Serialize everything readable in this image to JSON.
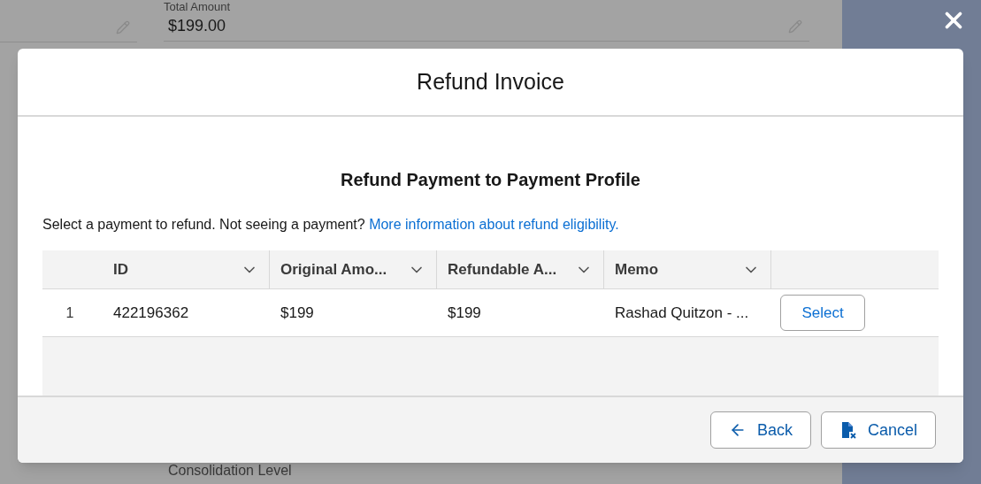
{
  "background": {
    "field_label": "Total Amount",
    "field_value": "$199.00",
    "bottom_label": "Consolidation Level"
  },
  "modal": {
    "title": "Refund Invoice",
    "heading": "Refund Payment to Payment Profile",
    "description": "Select a payment to refund. Not seeing a payment?",
    "link": "More information about refund eligibility.",
    "table": {
      "columns": [
        "ID",
        "Original Amo...",
        "Refundable A...",
        "Memo"
      ],
      "rows": [
        {
          "number": "1",
          "cells": [
            "422196362",
            "$199",
            "$199",
            "Rashad Quitzon - ..."
          ],
          "action": "Select"
        }
      ]
    },
    "buttons": [
      {
        "kind": "back",
        "label": "Back"
      },
      {
        "kind": "cancel",
        "label": "Cancel"
      }
    ]
  }
}
